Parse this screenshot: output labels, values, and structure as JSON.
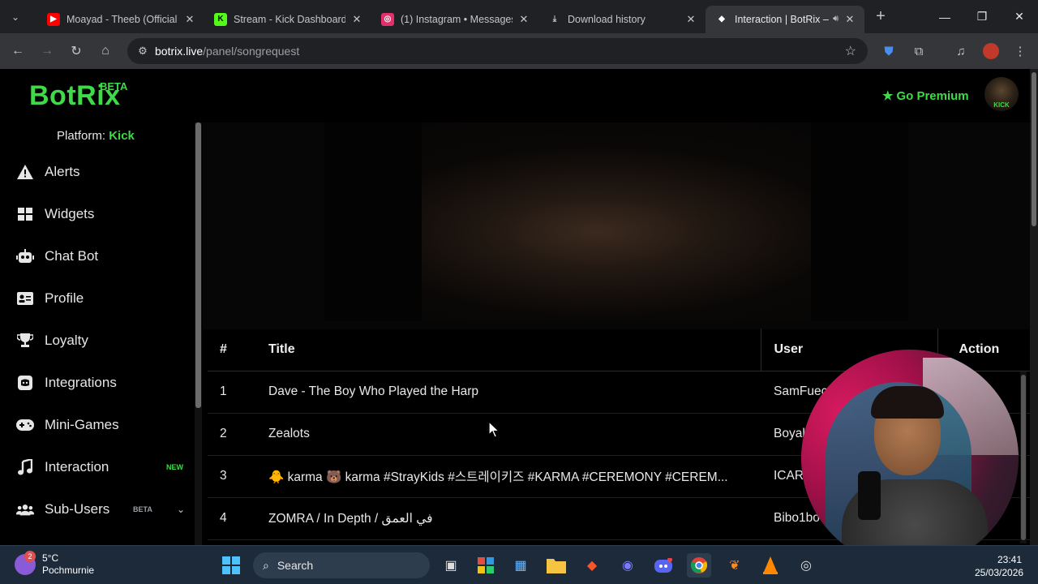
{
  "browser": {
    "tabs": [
      {
        "title": "Moayad - Theeb (Official",
        "icon": "youtube-icon",
        "color": "#ff0000"
      },
      {
        "title": "Stream - Kick Dashboard",
        "icon": "kick-icon",
        "color": "#53fc18"
      },
      {
        "title": "(1) Instagram • Messages",
        "icon": "instagram-icon",
        "color": "#e1306c"
      },
      {
        "title": "Download history",
        "icon": "download-icon",
        "color": "#c4c7c5"
      },
      {
        "title": "Interaction | BotRix –",
        "icon": "botrix-icon",
        "color": "#ffffff"
      }
    ],
    "url_host": "botrix.live",
    "url_path": "/panel/songrequest"
  },
  "header": {
    "logo": "BotRix",
    "beta": "BETA",
    "premium": "Go Premium",
    "avatar_badge": "KICK"
  },
  "sidebar": {
    "platform_label": "Platform:",
    "platform_value": "Kick",
    "items": [
      {
        "label": "Alerts",
        "icon": "warning-icon"
      },
      {
        "label": "Widgets",
        "icon": "widgets-icon"
      },
      {
        "label": "Chat Bot",
        "icon": "robot-icon"
      },
      {
        "label": "Profile",
        "icon": "id-card-icon"
      },
      {
        "label": "Loyalty",
        "icon": "trophy-icon"
      },
      {
        "label": "Integrations",
        "icon": "discord-icon"
      },
      {
        "label": "Mini-Games",
        "icon": "gamepad-icon"
      },
      {
        "label": "Interaction",
        "icon": "music-icon",
        "badge": "NEW"
      },
      {
        "label": "Sub-Users",
        "icon": "users-icon",
        "badge": "BETA"
      }
    ]
  },
  "queue": {
    "columns": [
      "#",
      "Title",
      "User",
      "Action"
    ],
    "rows": [
      {
        "num": "1",
        "title": "Dave - The Boy Who Played the Harp",
        "user": "SamFuec"
      },
      {
        "num": "2",
        "title": "Zealots",
        "user": "Boyal"
      },
      {
        "num": "3",
        "title": "🐥 karma 🐻 karma #StrayKids #스트레이키즈 #KARMA #CEREMONY #CEREM...",
        "user": "ICAR"
      },
      {
        "num": "4",
        "title": "ZOMRA / In Depth / في العمق",
        "user": "Bibo1bo"
      }
    ]
  },
  "taskbar": {
    "temp": "5°C",
    "location": "Pochmurnie",
    "weather_badge": "2",
    "search": "Search",
    "time": "23:41",
    "date": "25/03/2026"
  },
  "colors": {
    "brand": "#3fd94a",
    "new_badge": "#3fd94a",
    "beta_badge": "#9aa0a6"
  }
}
